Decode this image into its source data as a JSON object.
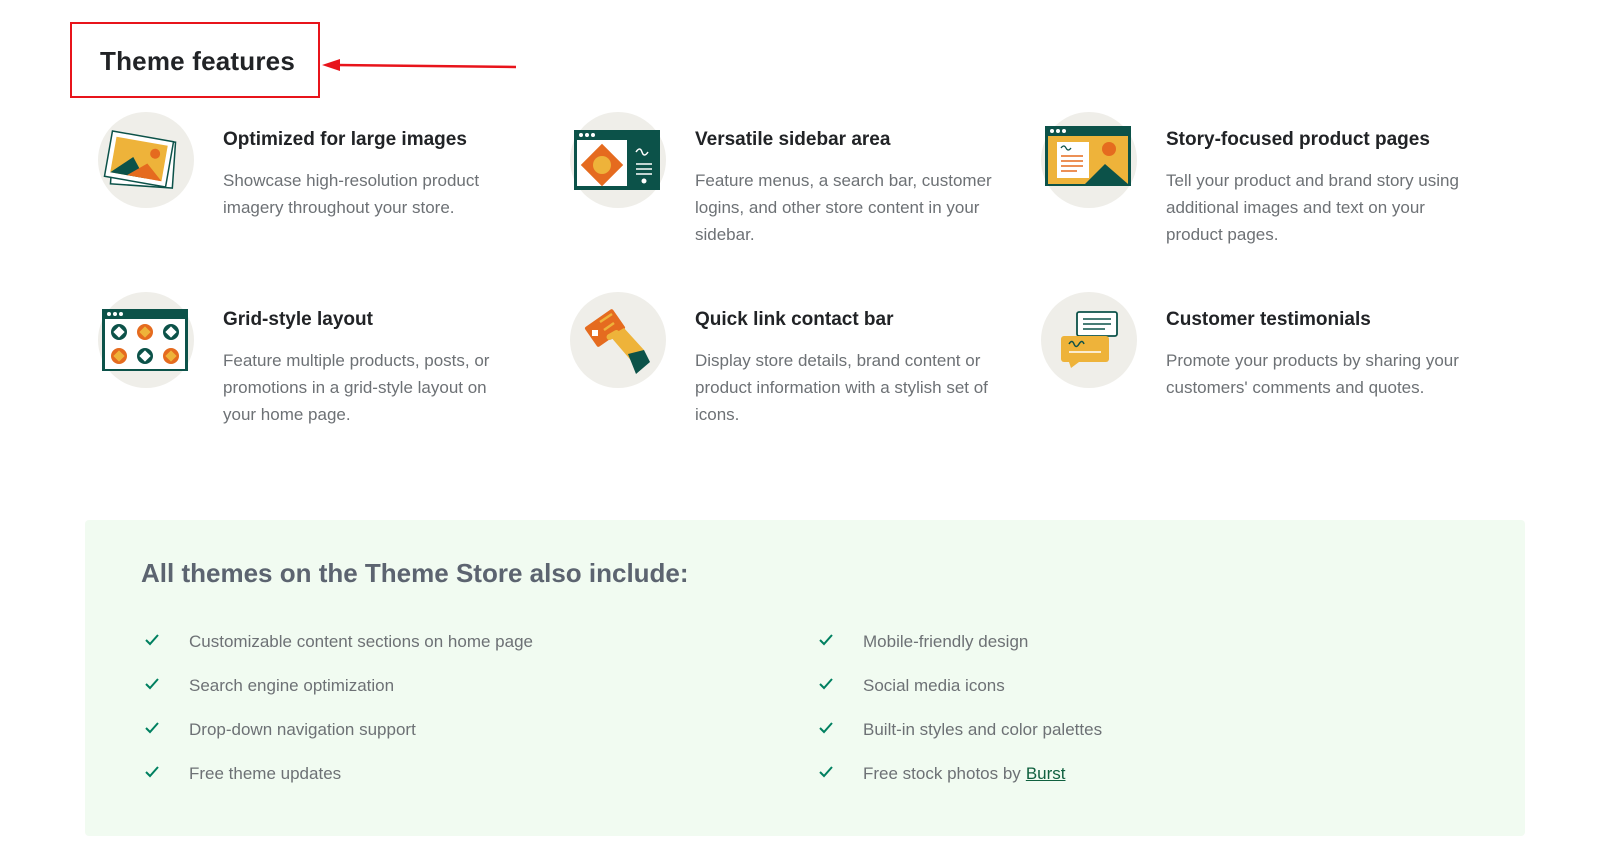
{
  "section": {
    "title": "Theme features"
  },
  "features": [
    {
      "title": "Optimized for large images",
      "desc": "Showcase high-resolution product imagery throughout your store.",
      "icon": "large-images-icon"
    },
    {
      "title": "Versatile sidebar area",
      "desc": "Feature menus, a search bar, customer logins, and other store content in your sidebar.",
      "icon": "sidebar-icon"
    },
    {
      "title": "Story-focused product pages",
      "desc": "Tell your product and brand story using additional images and text on your product pages.",
      "icon": "story-page-icon"
    },
    {
      "title": "Grid-style layout",
      "desc": "Feature multiple products, posts, or promotions in a grid-style layout on your home page.",
      "icon": "grid-layout-icon"
    },
    {
      "title": "Quick link contact bar",
      "desc": "Display store details, brand content or product information with a stylish set of icons.",
      "icon": "contact-card-icon"
    },
    {
      "title": "Customer testimonials",
      "desc": "Promote your products by sharing your customers' comments and quotes.",
      "icon": "testimonial-icon"
    }
  ],
  "includes": {
    "title": "All themes on the Theme Store also include:",
    "left": [
      "Customizable content sections on home page",
      "Search engine optimization",
      "Drop-down navigation support",
      "Free theme updates"
    ],
    "right": [
      "Mobile-friendly design",
      "Social media icons",
      "Built-in styles and color palettes",
      "Free stock photos by"
    ],
    "link_label": "Burst"
  },
  "colors": {
    "annotation": "#e8141b",
    "brand_green": "#10603f",
    "check_green": "#008060",
    "panel_bg": "#f1fbf1",
    "orange": "#e56b1f",
    "yellow": "#eeb33a",
    "teal": "#0c5249"
  }
}
